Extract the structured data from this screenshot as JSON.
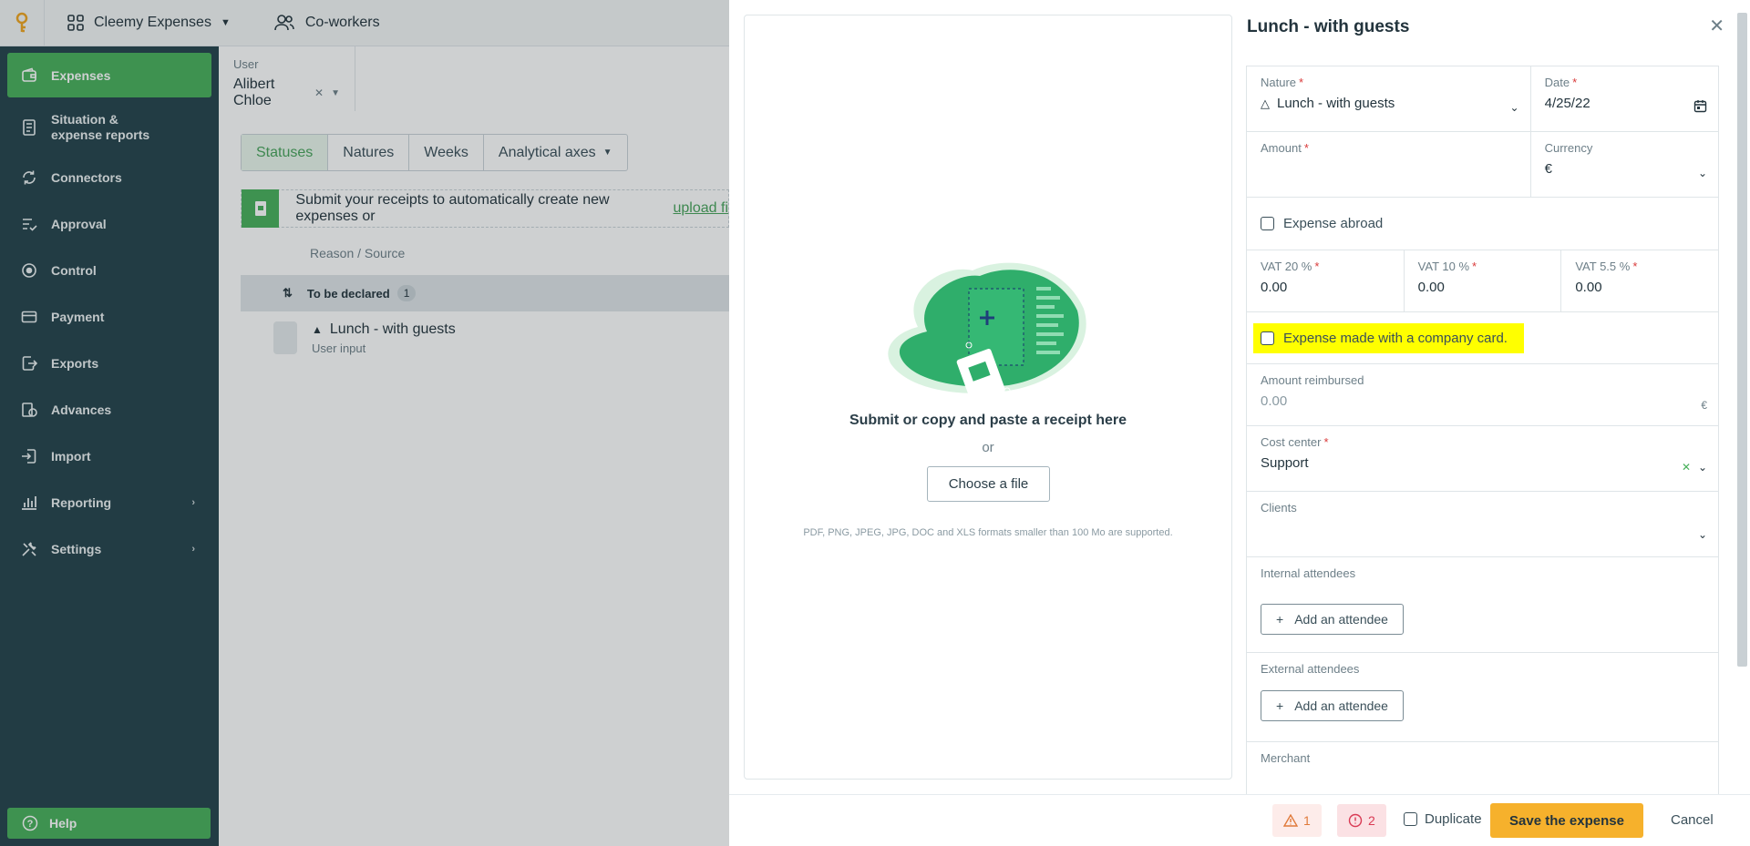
{
  "topbar": {
    "app_name": "Cleemy Expenses",
    "coworkers": "Co-workers"
  },
  "sidebar": {
    "items": [
      {
        "label": "Expenses",
        "icon": "wallet-icon"
      },
      {
        "label": "Situation & expense reports",
        "icon": "report-icon"
      },
      {
        "label": "Connectors",
        "icon": "sync-icon"
      },
      {
        "label": "Approval",
        "icon": "checklist-icon"
      },
      {
        "label": "Control",
        "icon": "eye-icon"
      },
      {
        "label": "Payment",
        "icon": "card-icon"
      },
      {
        "label": "Exports",
        "icon": "export-icon"
      },
      {
        "label": "Advances",
        "icon": "advances-icon"
      },
      {
        "label": "Import",
        "icon": "import-icon"
      },
      {
        "label": "Reporting",
        "icon": "chart-icon"
      },
      {
        "label": "Settings",
        "icon": "tools-icon"
      }
    ],
    "help": "Help"
  },
  "main": {
    "user_label": "User",
    "user_value": "Alibert Chloe",
    "tabs": [
      "Statuses",
      "Natures",
      "Weeks",
      "Analytical axes"
    ],
    "banner_text": "Submit your receipts to automatically create new expenses or",
    "banner_link": "upload fi",
    "column_header": "Reason / Source",
    "group_label": "To be declared",
    "group_count": "1",
    "expense_title": "Lunch - with guests",
    "expense_sub": "User input"
  },
  "receipt": {
    "prompt": "Submit or copy and paste a receipt here",
    "or": "or",
    "choose_file": "Choose a file",
    "formats": "PDF, PNG, JPEG, JPG, DOC and XLS formats smaller than 100 Mo are supported."
  },
  "form": {
    "title": "Lunch - with guests",
    "nature_label": "Nature",
    "nature_value": "Lunch - with guests",
    "date_label": "Date",
    "date_value": "4/25/22",
    "amount_label": "Amount",
    "currency_label": "Currency",
    "currency_value": "€",
    "expense_abroad": "Expense abroad",
    "vat20_label": "VAT 20 %",
    "vat20_value": "0.00",
    "vat10_label": "VAT 10 %",
    "vat10_value": "0.00",
    "vat55_label": "VAT 5.5 %",
    "vat55_value": "0.00",
    "company_card": "Expense made with a company card.",
    "reimbursed_label": "Amount reimbursed",
    "reimbursed_value": "0.00",
    "reimbursed_currency": "€",
    "cost_center_label": "Cost center",
    "cost_center_value": "Support",
    "clients_label": "Clients",
    "internal_label": "Internal attendees",
    "add_attendee": "Add an attendee",
    "external_label": "External attendees",
    "merchant_label": "Merchant",
    "required_mark": "*"
  },
  "footer": {
    "warnings": "1",
    "errors": "2",
    "duplicate": "Duplicate",
    "save": "Save the expense",
    "cancel": "Cancel"
  },
  "colors": {
    "brand_green": "#47b05a",
    "sidebar_bg": "#23424b",
    "save_button": "#f6b12c",
    "highlight": "#ffff00"
  }
}
